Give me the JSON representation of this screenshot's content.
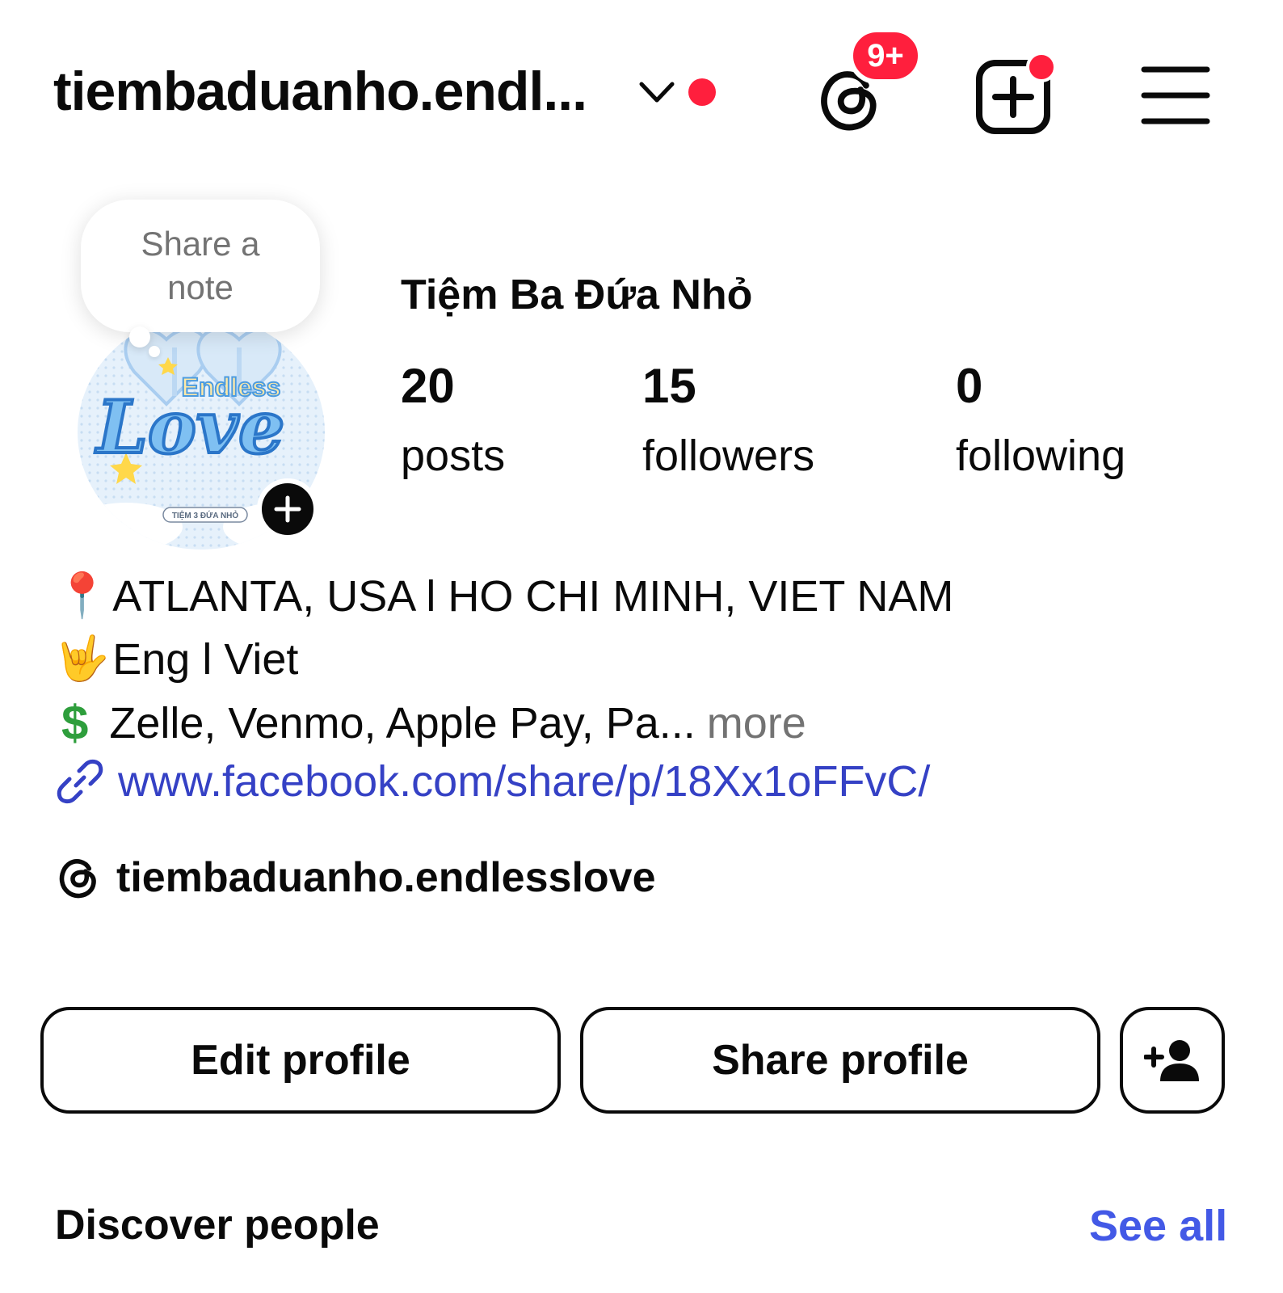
{
  "header": {
    "username": "tiembaduanho.endl...",
    "threads_badge": "9+"
  },
  "note": {
    "text": "Share a note"
  },
  "profile": {
    "display_name": "Tiệm Ba Đứa Nhỏ",
    "stats": [
      {
        "value": "20",
        "label": "posts"
      },
      {
        "value": "15",
        "label": "followers"
      },
      {
        "value": "0",
        "label": "following"
      }
    ],
    "avatar_text": {
      "title_top": "Endless",
      "title_main": "Love",
      "caption": "TIỆM 3 ĐỨA NHỎ"
    }
  },
  "bio": {
    "line1_emoji": "📍",
    "line1_text": "ATLANTA, USA l HO CHI MINH, VIET NAM",
    "line2_emoji": "🤟",
    "line2_text": "Eng l Viet",
    "line3_emoji": "$",
    "line3_text": "Zelle, Venmo, Apple Pay, Pa...",
    "line3_more": "more",
    "link_text": "www.facebook.com/share/p/18Xx1oFFvC/",
    "threads_handle": "tiembaduanho.endlesslove"
  },
  "actions": {
    "edit_profile": "Edit profile",
    "share_profile": "Share profile"
  },
  "discover": {
    "title": "Discover people",
    "see_all": "See all"
  },
  "colors": {
    "accent_blue": "#4359e6",
    "link_blue": "#3541c5",
    "notification_red": "#ff1f3d",
    "muted_gray": "#737373"
  }
}
